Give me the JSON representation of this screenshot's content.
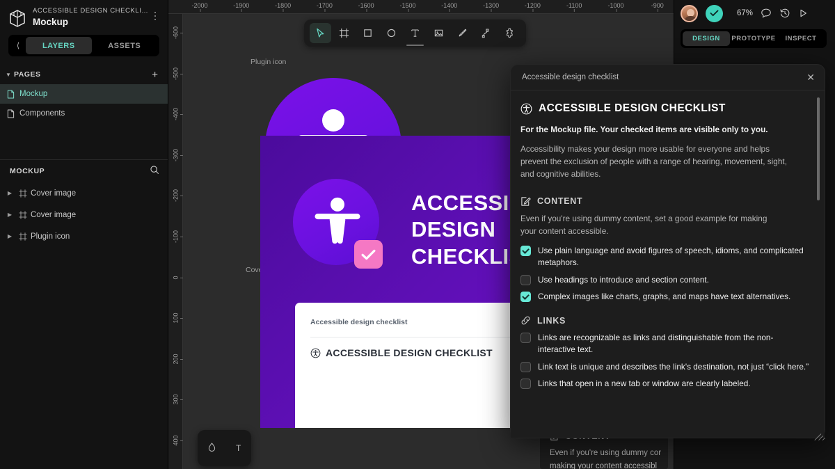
{
  "sidebar": {
    "project_name": "ACCESSIBLE DESIGN CHECKLIST",
    "file_name": "Mockup",
    "tabs": [
      {
        "label": "LAYERS",
        "active": true
      },
      {
        "label": "ASSETS",
        "active": false
      }
    ],
    "pages_header": "PAGES",
    "pages": [
      {
        "label": "Mockup",
        "active": true
      },
      {
        "label": "Components",
        "active": false
      }
    ],
    "layers_header": "MOCKUP",
    "layers": [
      {
        "label": "Cover image"
      },
      {
        "label": "Cover image"
      },
      {
        "label": "Plugin icon"
      }
    ]
  },
  "toolbar": {
    "tools": [
      {
        "name": "move-tool",
        "active": true
      },
      {
        "name": "frame-tool",
        "active": false
      },
      {
        "name": "rectangle-tool",
        "active": false
      },
      {
        "name": "ellipse-tool",
        "active": false
      },
      {
        "name": "text-tool",
        "active": false
      },
      {
        "name": "image-tool",
        "active": false
      },
      {
        "name": "pencil-tool",
        "active": false
      },
      {
        "name": "pen-tool",
        "active": false
      },
      {
        "name": "plugins-tool",
        "active": false
      }
    ]
  },
  "topbar": {
    "zoom": "67%",
    "comment_icon": "comment-icon",
    "history_icon": "history-icon",
    "present_icon": "play-icon",
    "tabs": [
      {
        "label": "DESIGN",
        "active": true
      },
      {
        "label": "PROTOTYPE",
        "active": false
      },
      {
        "label": "INSPECT",
        "active": false
      }
    ]
  },
  "rulers": {
    "horizontal": [
      "-2000",
      "-1900",
      "-1800",
      "-1700",
      "-1600",
      "-1500",
      "-1400",
      "-1300",
      "-1200",
      "-1100",
      "-1000",
      "-900"
    ],
    "vertical": [
      "-600",
      "-500",
      "-400",
      "-300",
      "-200",
      "-100",
      "0",
      "100",
      "200",
      "300",
      "400"
    ]
  },
  "canvas": {
    "frames": [
      {
        "label": "Plugin icon"
      },
      {
        "label": "Cover image"
      }
    ],
    "cover": {
      "title_lines": [
        "ACCESSIBLE",
        "DESIGN",
        "CHECKLIST"
      ],
      "card_header": "Accessible design checklist",
      "card_heading": "ACCESSIBLE DESIGN CHECKLIST"
    },
    "chip_tools": [
      "droplet-icon",
      "text-icon"
    ]
  },
  "plugin": {
    "window_title": "Accessible design checklist",
    "close_label": "✕",
    "heading": "ACCESSIBLE DESIGN CHECKLIST",
    "lead": "For the Mockup file. Your checked items are visible only to you.",
    "paragraph": "Accessibility makes your design more usable for everyone and helps prevent the exclusion of people with a range of hearing, movement, sight, and cognitive abilities.",
    "sections": [
      {
        "icon": "edit-square-icon",
        "title": "CONTENT",
        "description": "Even if you're using dummy content, set a good example for making your content accessible.",
        "items": [
          {
            "checked": true,
            "text": "Use plain language and avoid figures of speech, idioms, and complicated metaphors."
          },
          {
            "checked": false,
            "text": "Use headings to introduce and section content."
          },
          {
            "checked": true,
            "text": "Complex images like charts, graphs, and maps have text alternatives."
          }
        ]
      },
      {
        "icon": "link-icon",
        "title": "LINKS",
        "description": "",
        "items": [
          {
            "checked": false,
            "text": "Links are recognizable as links and distinguishable from the non-interactive text."
          },
          {
            "checked": false,
            "text": "Link text is unique and describes the link's destination, not just “click here.”"
          },
          {
            "checked": false,
            "text": "Links that open in a new tab or window are clearly labeled."
          }
        ]
      }
    ]
  },
  "background_card": {
    "section_title": "CONTENT",
    "line1": "Even if you're using dummy cor",
    "line2": "making your content accessibl"
  },
  "colors": {
    "accent_teal": "#67d7c4",
    "checkbox_on": "#67e8d6",
    "brand_purple": "#6b11e0",
    "brand_pink": "#f578c4",
    "panel_bg": "#131313",
    "canvas_bg": "#2c2c2c"
  }
}
